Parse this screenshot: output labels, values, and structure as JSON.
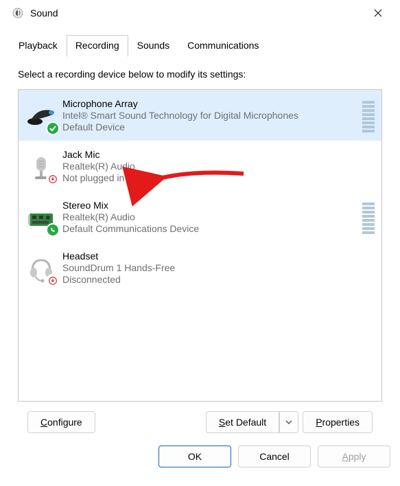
{
  "window": {
    "title": "Sound"
  },
  "tabs": [
    {
      "label": "Playback"
    },
    {
      "label": "Recording"
    },
    {
      "label": "Sounds"
    },
    {
      "label": "Communications"
    }
  ],
  "prompt": "Select a recording device below to modify its settings:",
  "devices": [
    {
      "name": "Microphone Array",
      "provider": "Intel® Smart Sound Technology for Digital Microphones",
      "status": "Default Device"
    },
    {
      "name": "Jack Mic",
      "provider": "Realtek(R) Audio",
      "status": "Not plugged in"
    },
    {
      "name": "Stereo Mix",
      "provider": "Realtek(R) Audio",
      "status": "Default Communications Device"
    },
    {
      "name": "Headset",
      "provider": "SoundDrum 1 Hands-Free",
      "status": "Disconnected"
    }
  ],
  "buttons": {
    "configure": "Configure",
    "set_default": "Set Default",
    "properties": "Properties",
    "ok": "OK",
    "cancel": "Cancel",
    "apply": "Apply"
  }
}
